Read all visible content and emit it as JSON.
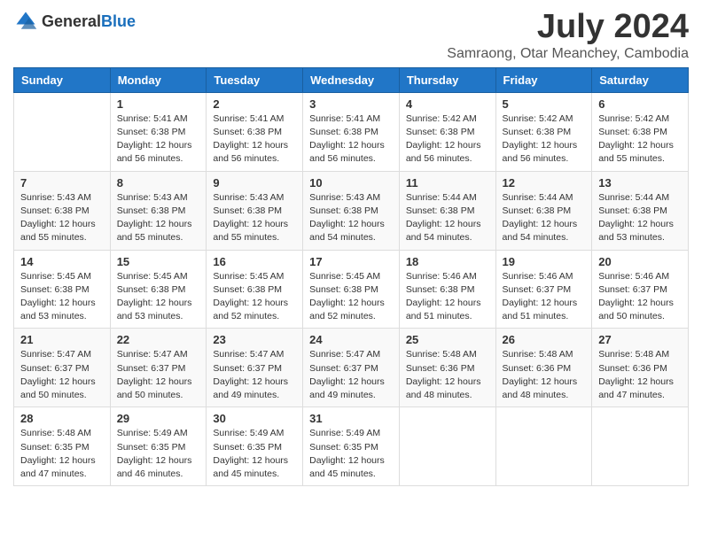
{
  "header": {
    "logo_general": "General",
    "logo_blue": "Blue",
    "title": "July 2024",
    "subtitle": "Samraong, Otar Meanchey, Cambodia"
  },
  "days_of_week": [
    "Sunday",
    "Monday",
    "Tuesday",
    "Wednesday",
    "Thursday",
    "Friday",
    "Saturday"
  ],
  "weeks": [
    [
      {
        "day": "",
        "sunrise": "",
        "sunset": "",
        "daylight": ""
      },
      {
        "day": "1",
        "sunrise": "Sunrise: 5:41 AM",
        "sunset": "Sunset: 6:38 PM",
        "daylight": "Daylight: 12 hours and 56 minutes."
      },
      {
        "day": "2",
        "sunrise": "Sunrise: 5:41 AM",
        "sunset": "Sunset: 6:38 PM",
        "daylight": "Daylight: 12 hours and 56 minutes."
      },
      {
        "day": "3",
        "sunrise": "Sunrise: 5:41 AM",
        "sunset": "Sunset: 6:38 PM",
        "daylight": "Daylight: 12 hours and 56 minutes."
      },
      {
        "day": "4",
        "sunrise": "Sunrise: 5:42 AM",
        "sunset": "Sunset: 6:38 PM",
        "daylight": "Daylight: 12 hours and 56 minutes."
      },
      {
        "day": "5",
        "sunrise": "Sunrise: 5:42 AM",
        "sunset": "Sunset: 6:38 PM",
        "daylight": "Daylight: 12 hours and 56 minutes."
      },
      {
        "day": "6",
        "sunrise": "Sunrise: 5:42 AM",
        "sunset": "Sunset: 6:38 PM",
        "daylight": "Daylight: 12 hours and 55 minutes."
      }
    ],
    [
      {
        "day": "7",
        "sunrise": "Sunrise: 5:43 AM",
        "sunset": "Sunset: 6:38 PM",
        "daylight": "Daylight: 12 hours and 55 minutes."
      },
      {
        "day": "8",
        "sunrise": "Sunrise: 5:43 AM",
        "sunset": "Sunset: 6:38 PM",
        "daylight": "Daylight: 12 hours and 55 minutes."
      },
      {
        "day": "9",
        "sunrise": "Sunrise: 5:43 AM",
        "sunset": "Sunset: 6:38 PM",
        "daylight": "Daylight: 12 hours and 55 minutes."
      },
      {
        "day": "10",
        "sunrise": "Sunrise: 5:43 AM",
        "sunset": "Sunset: 6:38 PM",
        "daylight": "Daylight: 12 hours and 54 minutes."
      },
      {
        "day": "11",
        "sunrise": "Sunrise: 5:44 AM",
        "sunset": "Sunset: 6:38 PM",
        "daylight": "Daylight: 12 hours and 54 minutes."
      },
      {
        "day": "12",
        "sunrise": "Sunrise: 5:44 AM",
        "sunset": "Sunset: 6:38 PM",
        "daylight": "Daylight: 12 hours and 54 minutes."
      },
      {
        "day": "13",
        "sunrise": "Sunrise: 5:44 AM",
        "sunset": "Sunset: 6:38 PM",
        "daylight": "Daylight: 12 hours and 53 minutes."
      }
    ],
    [
      {
        "day": "14",
        "sunrise": "Sunrise: 5:45 AM",
        "sunset": "Sunset: 6:38 PM",
        "daylight": "Daylight: 12 hours and 53 minutes."
      },
      {
        "day": "15",
        "sunrise": "Sunrise: 5:45 AM",
        "sunset": "Sunset: 6:38 PM",
        "daylight": "Daylight: 12 hours and 53 minutes."
      },
      {
        "day": "16",
        "sunrise": "Sunrise: 5:45 AM",
        "sunset": "Sunset: 6:38 PM",
        "daylight": "Daylight: 12 hours and 52 minutes."
      },
      {
        "day": "17",
        "sunrise": "Sunrise: 5:45 AM",
        "sunset": "Sunset: 6:38 PM",
        "daylight": "Daylight: 12 hours and 52 minutes."
      },
      {
        "day": "18",
        "sunrise": "Sunrise: 5:46 AM",
        "sunset": "Sunset: 6:38 PM",
        "daylight": "Daylight: 12 hours and 51 minutes."
      },
      {
        "day": "19",
        "sunrise": "Sunrise: 5:46 AM",
        "sunset": "Sunset: 6:37 PM",
        "daylight": "Daylight: 12 hours and 51 minutes."
      },
      {
        "day": "20",
        "sunrise": "Sunrise: 5:46 AM",
        "sunset": "Sunset: 6:37 PM",
        "daylight": "Daylight: 12 hours and 50 minutes."
      }
    ],
    [
      {
        "day": "21",
        "sunrise": "Sunrise: 5:47 AM",
        "sunset": "Sunset: 6:37 PM",
        "daylight": "Daylight: 12 hours and 50 minutes."
      },
      {
        "day": "22",
        "sunrise": "Sunrise: 5:47 AM",
        "sunset": "Sunset: 6:37 PM",
        "daylight": "Daylight: 12 hours and 50 minutes."
      },
      {
        "day": "23",
        "sunrise": "Sunrise: 5:47 AM",
        "sunset": "Sunset: 6:37 PM",
        "daylight": "Daylight: 12 hours and 49 minutes."
      },
      {
        "day": "24",
        "sunrise": "Sunrise: 5:47 AM",
        "sunset": "Sunset: 6:37 PM",
        "daylight": "Daylight: 12 hours and 49 minutes."
      },
      {
        "day": "25",
        "sunrise": "Sunrise: 5:48 AM",
        "sunset": "Sunset: 6:36 PM",
        "daylight": "Daylight: 12 hours and 48 minutes."
      },
      {
        "day": "26",
        "sunrise": "Sunrise: 5:48 AM",
        "sunset": "Sunset: 6:36 PM",
        "daylight": "Daylight: 12 hours and 48 minutes."
      },
      {
        "day": "27",
        "sunrise": "Sunrise: 5:48 AM",
        "sunset": "Sunset: 6:36 PM",
        "daylight": "Daylight: 12 hours and 47 minutes."
      }
    ],
    [
      {
        "day": "28",
        "sunrise": "Sunrise: 5:48 AM",
        "sunset": "Sunset: 6:35 PM",
        "daylight": "Daylight: 12 hours and 47 minutes."
      },
      {
        "day": "29",
        "sunrise": "Sunrise: 5:49 AM",
        "sunset": "Sunset: 6:35 PM",
        "daylight": "Daylight: 12 hours and 46 minutes."
      },
      {
        "day": "30",
        "sunrise": "Sunrise: 5:49 AM",
        "sunset": "Sunset: 6:35 PM",
        "daylight": "Daylight: 12 hours and 45 minutes."
      },
      {
        "day": "31",
        "sunrise": "Sunrise: 5:49 AM",
        "sunset": "Sunset: 6:35 PM",
        "daylight": "Daylight: 12 hours and 45 minutes."
      },
      {
        "day": "",
        "sunrise": "",
        "sunset": "",
        "daylight": ""
      },
      {
        "day": "",
        "sunrise": "",
        "sunset": "",
        "daylight": ""
      },
      {
        "day": "",
        "sunrise": "",
        "sunset": "",
        "daylight": ""
      }
    ]
  ]
}
